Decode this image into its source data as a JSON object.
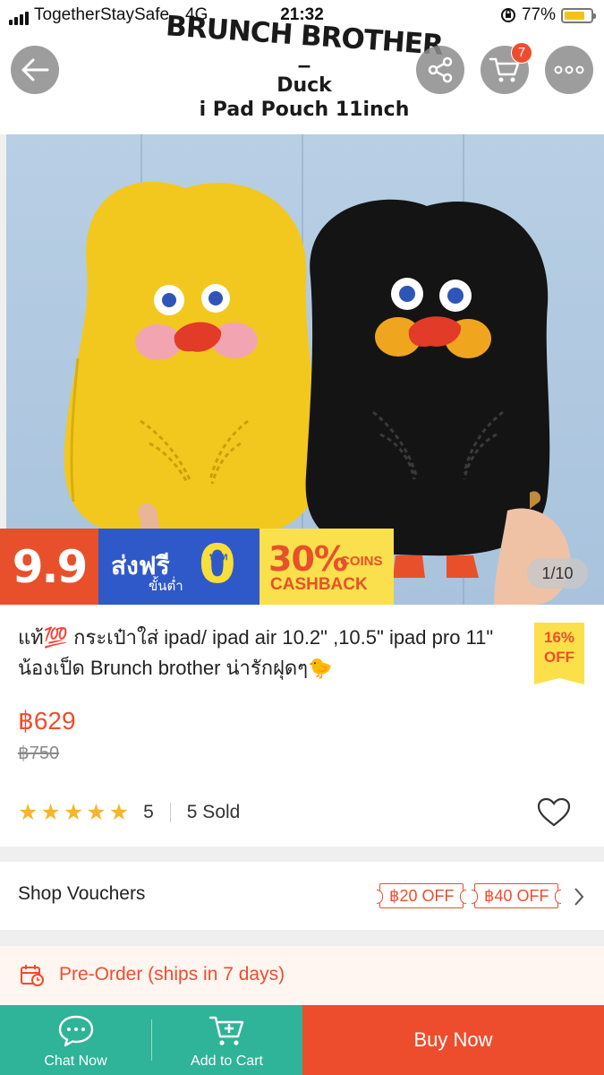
{
  "status_bar": {
    "carrier": "TogetherStaySafe",
    "network": "4G",
    "time": "21:32",
    "battery_percent": "77%",
    "battery_level": 0.77
  },
  "header": {
    "brand_name": "BRUNCH BROTHER",
    "brand_dash": "–",
    "banner_line1": "Duck",
    "banner_line2": "i Pad Pouch 11inch",
    "cart_count": "7"
  },
  "gallery": {
    "counter": "1/10"
  },
  "promo": {
    "event": "9.9",
    "free_shipping": "ส่งฟรี",
    "free_shipping_sub": "ขั้นต่ำ",
    "zero": "0",
    "zero_unit": "บาท",
    "cashback_pct": "30%",
    "cashback_coins": "COINS",
    "cashback_label": "CASHBACK"
  },
  "product": {
    "title": "แท้💯 กระเป๋าใส่ ipad/ ipad air 10.2\" ,10.5\" ipad pro 11\" น้องเป็ด Brunch brother น่ารักฝุดๆ🐤",
    "discount_pct": "16%",
    "discount_label": "OFF",
    "price": "฿629",
    "original_price": "฿750",
    "rating": "5",
    "rating_stars": 5,
    "sold": "5 Sold"
  },
  "vouchers": {
    "label": "Shop Vouchers",
    "items": [
      "฿20 OFF",
      "฿40 OFF"
    ]
  },
  "preorder": {
    "text": "Pre-Order (ships in 7 days)"
  },
  "bottom_bar": {
    "chat_label": "Chat Now",
    "cart_label": "Add to Cart",
    "buy_label": "Buy Now"
  },
  "colors": {
    "accent": "#ee4d2d",
    "teal": "#2fb399",
    "star": "#f7b52c"
  }
}
